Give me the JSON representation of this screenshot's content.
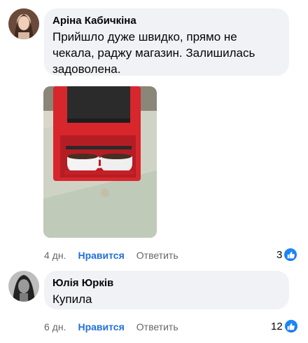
{
  "comments": [
    {
      "author": "Аріна Кабичкіна",
      "text": "Прийшло дуже швидко, прямо не чекала, раджу магазин. Залишилась задоволена.",
      "time": "4 дн.",
      "like_label": "Нравится",
      "reply_label": "Ответить",
      "reactions_count": "3"
    },
    {
      "author": "Юлія Юрків",
      "text": "Купила",
      "time": "6 дн.",
      "like_label": "Нравится",
      "reply_label": "Ответить",
      "reactions_count": "12"
    }
  ],
  "icons": {
    "reaction": "like-thumb-icon"
  },
  "colors": {
    "bubble": "#f0f2f5",
    "link": "#216fdb",
    "meta": "#65676b",
    "like_icon": "#1877f2"
  }
}
